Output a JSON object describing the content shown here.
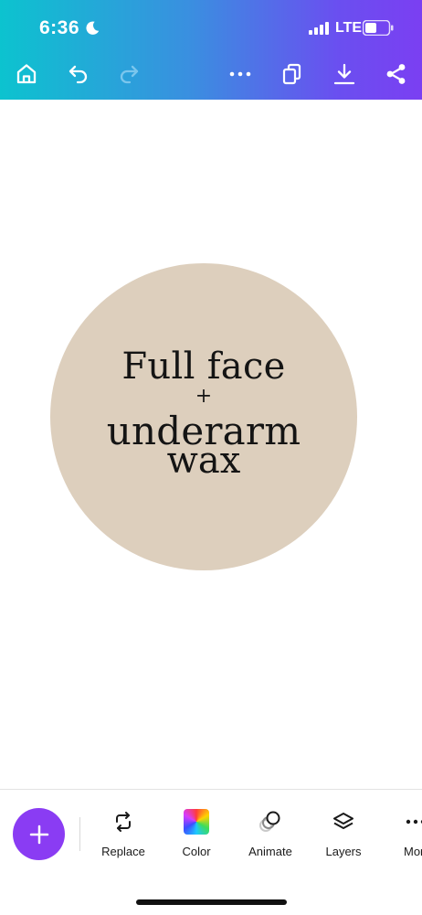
{
  "status_bar": {
    "time": "6:36",
    "network": "LTE"
  },
  "toolbar": {
    "icons": [
      "home-icon",
      "undo-icon",
      "redo-icon",
      "more-icon",
      "duplicate-pages-icon",
      "download-icon",
      "share-icon"
    ]
  },
  "design": {
    "line1": "Full face",
    "plus": "+",
    "line2": "underarm",
    "line3": "wax",
    "circle_color": "#ddcfbd"
  },
  "bottom_toolbar": {
    "tools": [
      {
        "label": "Replace",
        "icon": "replace-icon"
      },
      {
        "label": "Color",
        "icon": "color-icon"
      },
      {
        "label": "Animate",
        "icon": "animate-icon"
      },
      {
        "label": "Layers",
        "icon": "layers-icon"
      },
      {
        "label": "Mor",
        "icon": "more-icon"
      }
    ]
  },
  "colors": {
    "accent": "#8a3cf3",
    "header_gradient_start": "#0cc3cf",
    "header_gradient_end": "#7b3ff2"
  }
}
